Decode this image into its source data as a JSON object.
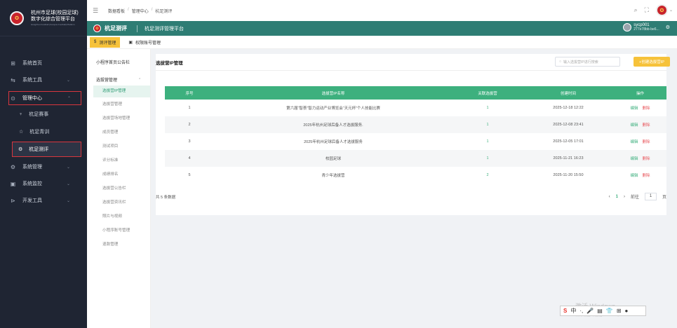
{
  "sidebar": {
    "logo_line1": "杭州市足球(校园足球)",
    "logo_line2": "数字化综合管理平台",
    "logo_sub": "Hangzhou Football (Campus Football) Platform",
    "items": [
      {
        "label": "系统首页",
        "icon": "grid-icon"
      },
      {
        "label": "系统工具",
        "icon": "tools-icon"
      },
      {
        "label": "管理中心",
        "icon": "manage-icon"
      },
      {
        "label": "杭足赛事",
        "icon": "trophy-icon"
      },
      {
        "label": "杭足青训",
        "icon": "training-icon"
      },
      {
        "label": "杭足测评",
        "icon": "assessment-icon"
      },
      {
        "label": "系统管理",
        "icon": "settings-icon"
      },
      {
        "label": "系统监控",
        "icon": "monitor-icon"
      },
      {
        "label": "开发工具",
        "icon": "dev-icon"
      }
    ]
  },
  "breadcrumb": [
    "数据看板",
    "管理中心",
    "杭足测评"
  ],
  "appbar": {
    "name": "杭足测评",
    "title": "杭足测评管理平台",
    "user_name": "sycp001",
    "user_id": "277e78bb-be6..."
  },
  "subtabs": [
    "测评管理",
    "权限账号管理"
  ],
  "sidenav2": {
    "title": "小程序首页公告栏",
    "group": "选拔营管理",
    "items": [
      "选拔营IP管理",
      "选拔营管理",
      "选拔营场地管理",
      "成员管理",
      "测试项目",
      "评分标准",
      "成绩排名",
      "选拔营公告栏",
      "选拔营资讯栏",
      "照片与视频",
      "小程序账号管理",
      "退款管理"
    ]
  },
  "main": {
    "title": "选拔营IP管理",
    "search_placeholder": "输入选拔营IP进行搜索",
    "create_label": "+创建选拔营IP",
    "columns": [
      "序号",
      "选拔营IP名称",
      "关联选拔营",
      "创建时间",
      "操作"
    ],
    "rows": [
      {
        "no": "1",
        "name": "第六届“智荟”智力运动产业博览会“天元杯”个人技能比赛",
        "count": "1",
        "time": "2025-12-18 12:22"
      },
      {
        "no": "2",
        "name": "2025年杭州足球后备人才选拔服务.",
        "count": "1",
        "time": "2025-12-08 23:41"
      },
      {
        "no": "3",
        "name": "2025年杭州足球后备人才选拔服务",
        "count": "1",
        "time": "2025-12-05 17:01"
      },
      {
        "no": "4",
        "name": "校园足球",
        "count": "1",
        "time": "2025-11-21 16:23"
      },
      {
        "no": "5",
        "name": "青少年选拔营",
        "count": "2",
        "time": "2025-11-20 15:50"
      }
    ],
    "edit_label": "编辑",
    "delete_label": "删除",
    "total": "共 5 条数据",
    "page": "1",
    "goto_label": "前往",
    "goto_value": "1",
    "page_unit": "页"
  },
  "ime": {
    "chars": [
      "中",
      "·,",
      "🎤",
      "▤",
      "👕",
      "⊞",
      "●"
    ]
  },
  "watermark": {
    "line1": "激活 Windows",
    "line2": "转到\"设置\"以激活 Windows。"
  }
}
